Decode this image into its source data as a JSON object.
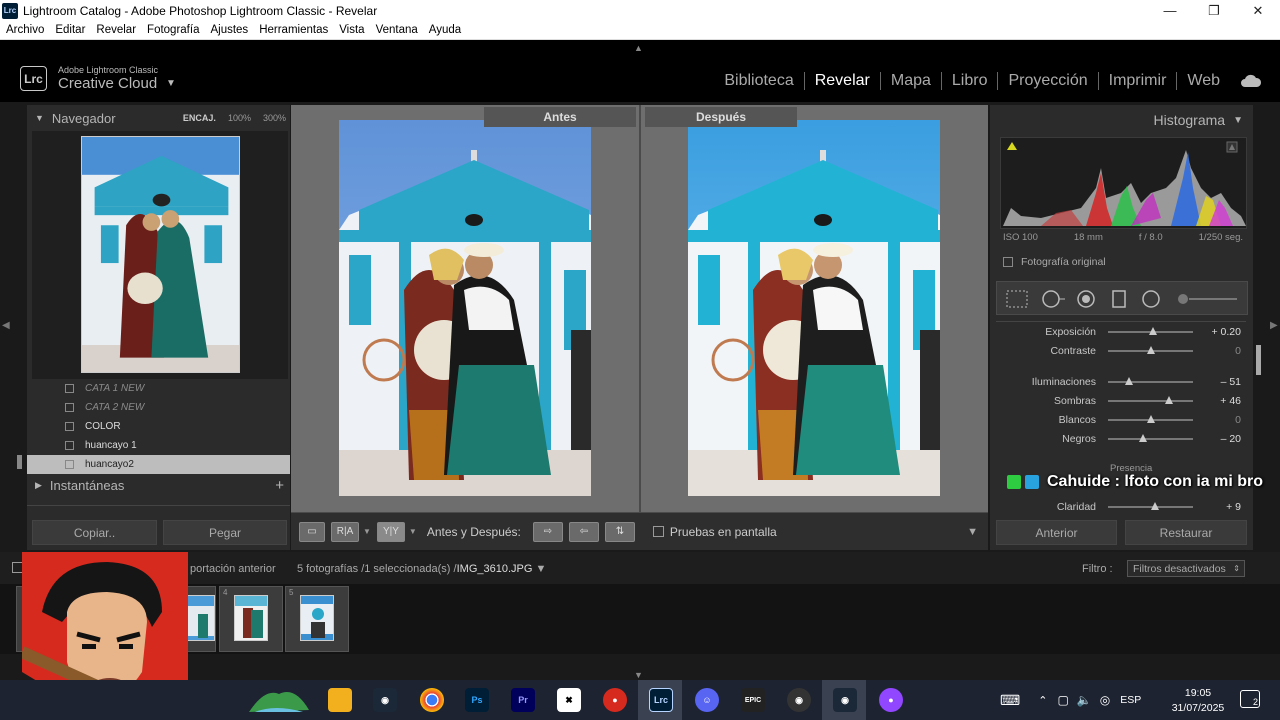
{
  "window": {
    "title": "Lightroom Catalog - Adobe Photoshop Lightroom Classic - Revelar",
    "app_icon": "Lrc",
    "buttons": [
      "minimize",
      "restore",
      "close"
    ]
  },
  "menubar": [
    "Archivo",
    "Editar",
    "Revelar",
    "Fotografía",
    "Ajustes",
    "Herramientas",
    "Vista",
    "Ventana",
    "Ayuda"
  ],
  "brand": {
    "badge": "Lrc",
    "line1": "Adobe Lightroom Classic",
    "line2": "Creative Cloud"
  },
  "modules": [
    {
      "label": "Biblioteca",
      "active": false
    },
    {
      "label": "Revelar",
      "active": true
    },
    {
      "label": "Mapa",
      "active": false
    },
    {
      "label": "Libro",
      "active": false
    },
    {
      "label": "Proyección",
      "active": false
    },
    {
      "label": "Imprimir",
      "active": false
    },
    {
      "label": "Web",
      "active": false
    }
  ],
  "navigator": {
    "title": "Navegador",
    "zoom_fit": "ENCAJ.",
    "zoom_100": "100%",
    "zoom_300": "300%"
  },
  "collections": [
    {
      "label": "CATA 1 NEW",
      "state": "dim"
    },
    {
      "label": "CATA 2 NEW",
      "state": "dim"
    },
    {
      "label": "COLOR",
      "state": "normal"
    },
    {
      "label": "huancayo 1",
      "state": "normal"
    },
    {
      "label": "huancayo2",
      "state": "selected"
    }
  ],
  "snapshots": {
    "title": "Instantáneas",
    "add": "+"
  },
  "left_buttons": {
    "copy": "Copiar..",
    "paste": "Pegar"
  },
  "compare": {
    "before_label": "Antes",
    "after_label": "Después"
  },
  "toolbar": {
    "view_yy": "Y|Y",
    "view_ra": "R|A",
    "before_after_label": "Antes y Después:",
    "softproof_label": "Pruebas en pantalla"
  },
  "histogram": {
    "title": "Histograma",
    "iso": "ISO 100",
    "focal": "18 mm",
    "aperture": "f / 8.0",
    "shutter": "1/250 seg.",
    "original_photo": "Fotografía original"
  },
  "sliders": [
    {
      "label": "Exposición",
      "value": "+ 0.20",
      "pos": 0.53,
      "zero": false
    },
    {
      "label": "Contraste",
      "value": "0",
      "pos": 0.5,
      "zero": true
    },
    {
      "label": "Iluminaciones",
      "value": "– 51",
      "pos": 0.25,
      "zero": false
    },
    {
      "label": "Sombras",
      "value": "+ 46",
      "pos": 0.72,
      "zero": false
    },
    {
      "label": "Blancos",
      "value": "0",
      "pos": 0.5,
      "zero": true
    },
    {
      "label": "Negros",
      "value": "– 20",
      "pos": 0.41,
      "zero": false
    },
    {
      "label": "Claridad",
      "value": "+ 9",
      "pos": 0.55,
      "zero": false
    }
  ],
  "presence_label": "Presencia",
  "right_buttons": {
    "previous": "Anterior",
    "reset": "Restaurar"
  },
  "chat_overlay": "Cahuide : lfoto con ia mi bro",
  "filmstrip": {
    "source": "portación anterior",
    "count": "5 fotografías /1 seleccionada(s) /",
    "filename": "IMG_3610.JPG",
    "filter_label": "Filtro :",
    "filter_value": "Filtros desactivados",
    "cells": [
      {
        "num": "4"
      },
      {
        "num": "5"
      }
    ]
  },
  "taskbar": {
    "icons": [
      "game-icon",
      "file-explorer-icon",
      "steam-icon",
      "chrome-icon",
      "photoshop-icon",
      "premiere-icon",
      "capcut-icon",
      "recorder-icon",
      "lightroom-icon",
      "discord-icon",
      "epic-games-icon",
      "obs-icon",
      "steam-icon",
      "twitch-icon"
    ],
    "lang": "ESP",
    "time": "19:05",
    "date": "31/07/2025",
    "notifications": "2"
  },
  "colors": {
    "accent": "#dddddd",
    "panel": "#2b2b2b",
    "webcam_bg": "#d62a1f"
  }
}
